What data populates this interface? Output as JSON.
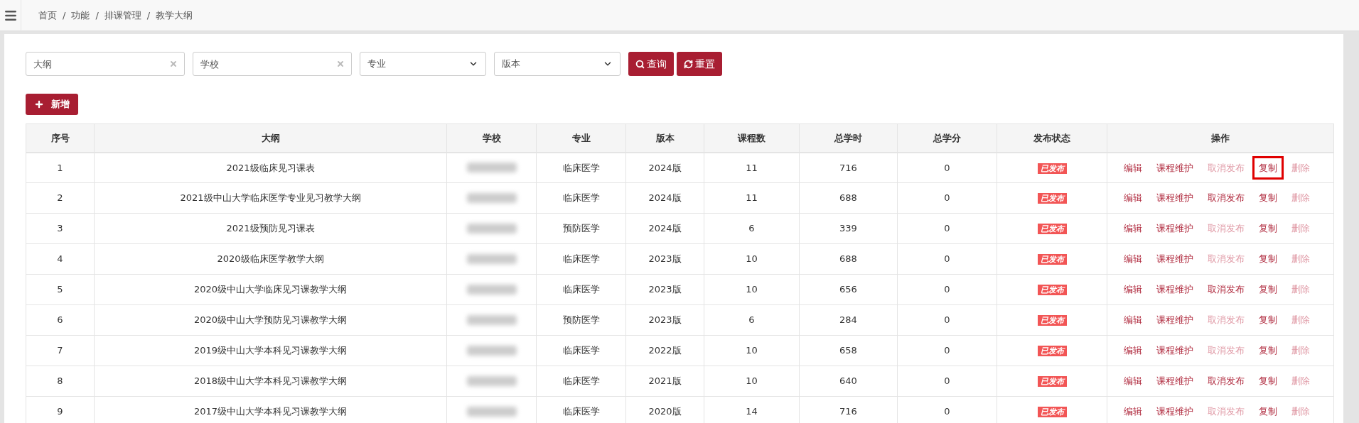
{
  "breadcrumb": [
    "首页",
    "功能",
    "排课管理",
    "教学大纲"
  ],
  "breadcrumb_separator": "/",
  "filters": [
    {
      "kind": "text",
      "placeholder": "大纲"
    },
    {
      "kind": "text",
      "placeholder": "学校"
    },
    {
      "kind": "select",
      "value": "专业"
    },
    {
      "kind": "select",
      "value": "版本"
    }
  ],
  "search_button": "查询",
  "reset_button": "重置",
  "add_button": "新增",
  "table": {
    "columns": [
      "序号",
      "大纲",
      "学校",
      "专业",
      "版本",
      "课程数",
      "总学时",
      "总学分",
      "发布状态",
      "操作"
    ],
    "rows": [
      {
        "index": "1",
        "outline": "2021级临床见习课表",
        "major": "临床医学",
        "version": "2024版",
        "courses": "11",
        "hours": "716",
        "credits": "0",
        "status": "已发布",
        "actions": [
          {
            "label": "编辑",
            "disabled": false,
            "highlighted": false
          },
          {
            "label": "课程维护",
            "disabled": false,
            "highlighted": false
          },
          {
            "label": "取消发布",
            "disabled": true,
            "highlighted": false
          },
          {
            "label": "复制",
            "disabled": false,
            "highlighted": true
          },
          {
            "label": "删除",
            "disabled": true,
            "highlighted": false
          }
        ]
      },
      {
        "index": "2",
        "outline": "2021级中山大学临床医学专业见习教学大纲",
        "major": "临床医学",
        "version": "2024版",
        "courses": "11",
        "hours": "688",
        "credits": "0",
        "status": "已发布",
        "actions": [
          {
            "label": "编辑",
            "disabled": false,
            "highlighted": false
          },
          {
            "label": "课程维护",
            "disabled": false,
            "highlighted": false
          },
          {
            "label": "取消发布",
            "disabled": false,
            "highlighted": false
          },
          {
            "label": "复制",
            "disabled": false,
            "highlighted": false
          },
          {
            "label": "删除",
            "disabled": true,
            "highlighted": false
          }
        ]
      },
      {
        "index": "3",
        "outline": "2021级预防见习课表",
        "major": "预防医学",
        "version": "2024版",
        "courses": "6",
        "hours": "339",
        "credits": "0",
        "status": "已发布",
        "actions": [
          {
            "label": "编辑",
            "disabled": false,
            "highlighted": false
          },
          {
            "label": "课程维护",
            "disabled": false,
            "highlighted": false
          },
          {
            "label": "取消发布",
            "disabled": true,
            "highlighted": false
          },
          {
            "label": "复制",
            "disabled": false,
            "highlighted": false
          },
          {
            "label": "删除",
            "disabled": true,
            "highlighted": false
          }
        ]
      },
      {
        "index": "4",
        "outline": "2020级临床医学教学大纲",
        "major": "临床医学",
        "version": "2023版",
        "courses": "10",
        "hours": "688",
        "credits": "0",
        "status": "已发布",
        "actions": [
          {
            "label": "编辑",
            "disabled": false,
            "highlighted": false
          },
          {
            "label": "课程维护",
            "disabled": false,
            "highlighted": false
          },
          {
            "label": "取消发布",
            "disabled": true,
            "highlighted": false
          },
          {
            "label": "复制",
            "disabled": false,
            "highlighted": false
          },
          {
            "label": "删除",
            "disabled": true,
            "highlighted": false
          }
        ]
      },
      {
        "index": "5",
        "outline": "2020级中山大学临床见习课教学大纲",
        "major": "临床医学",
        "version": "2023版",
        "courses": "10",
        "hours": "656",
        "credits": "0",
        "status": "已发布",
        "actions": [
          {
            "label": "编辑",
            "disabled": false,
            "highlighted": false
          },
          {
            "label": "课程维护",
            "disabled": false,
            "highlighted": false
          },
          {
            "label": "取消发布",
            "disabled": false,
            "highlighted": false
          },
          {
            "label": "复制",
            "disabled": false,
            "highlighted": false
          },
          {
            "label": "删除",
            "disabled": true,
            "highlighted": false
          }
        ]
      },
      {
        "index": "6",
        "outline": "2020级中山大学预防见习课教学大纲",
        "major": "预防医学",
        "version": "2023版",
        "courses": "6",
        "hours": "284",
        "credits": "0",
        "status": "已发布",
        "actions": [
          {
            "label": "编辑",
            "disabled": false,
            "highlighted": false
          },
          {
            "label": "课程维护",
            "disabled": false,
            "highlighted": false
          },
          {
            "label": "取消发布",
            "disabled": true,
            "highlighted": false
          },
          {
            "label": "复制",
            "disabled": false,
            "highlighted": false
          },
          {
            "label": "删除",
            "disabled": true,
            "highlighted": false
          }
        ]
      },
      {
        "index": "7",
        "outline": "2019级中山大学本科见习课教学大纲",
        "major": "临床医学",
        "version": "2022版",
        "courses": "10",
        "hours": "658",
        "credits": "0",
        "status": "已发布",
        "actions": [
          {
            "label": "编辑",
            "disabled": false,
            "highlighted": false
          },
          {
            "label": "课程维护",
            "disabled": false,
            "highlighted": false
          },
          {
            "label": "取消发布",
            "disabled": true,
            "highlighted": false
          },
          {
            "label": "复制",
            "disabled": false,
            "highlighted": false
          },
          {
            "label": "删除",
            "disabled": true,
            "highlighted": false
          }
        ]
      },
      {
        "index": "8",
        "outline": "2018级中山大学本科见习课教学大纲",
        "major": "临床医学",
        "version": "2021版",
        "courses": "10",
        "hours": "640",
        "credits": "0",
        "status": "已发布",
        "actions": [
          {
            "label": "编辑",
            "disabled": false,
            "highlighted": false
          },
          {
            "label": "课程维护",
            "disabled": false,
            "highlighted": false
          },
          {
            "label": "取消发布",
            "disabled": false,
            "highlighted": false
          },
          {
            "label": "复制",
            "disabled": false,
            "highlighted": false
          },
          {
            "label": "删除",
            "disabled": true,
            "highlighted": false
          }
        ]
      },
      {
        "index": "9",
        "outline": "2017级中山大学本科见习课教学大纲",
        "major": "临床医学",
        "version": "2020版",
        "courses": "14",
        "hours": "716",
        "credits": "0",
        "status": "已发布",
        "actions": [
          {
            "label": "编辑",
            "disabled": false,
            "highlighted": false
          },
          {
            "label": "课程维护",
            "disabled": false,
            "highlighted": false
          },
          {
            "label": "取消发布",
            "disabled": true,
            "highlighted": false
          },
          {
            "label": "复制",
            "disabled": false,
            "highlighted": false
          },
          {
            "label": "删除",
            "disabled": true,
            "highlighted": false
          }
        ]
      }
    ]
  }
}
